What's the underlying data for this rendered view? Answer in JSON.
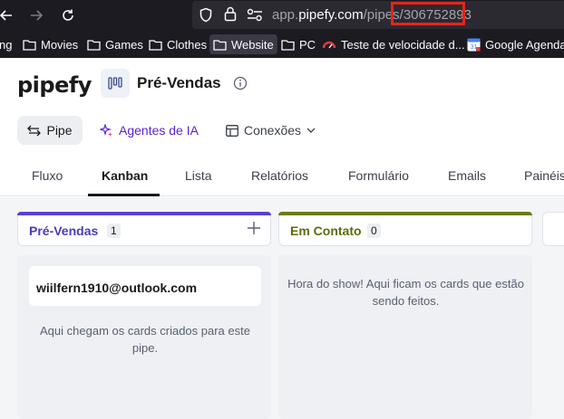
{
  "browser": {
    "url_prefix": "app.",
    "url_host": "pipefy.com",
    "url_path": "/pipes/",
    "url_pipe_id": "306752893"
  },
  "bookmarks": [
    {
      "label": "ng",
      "type": "folder"
    },
    {
      "label": "Movies",
      "type": "folder"
    },
    {
      "label": "Games",
      "type": "folder"
    },
    {
      "label": "Clothes",
      "type": "folder"
    },
    {
      "label": "Website",
      "type": "folder"
    },
    {
      "label": "PC",
      "type": "folder"
    },
    {
      "label": "Teste de velocidade d...",
      "type": "speedtest"
    },
    {
      "label": "Google Agenda",
      "type": "calendar"
    }
  ],
  "app": {
    "logo_text": "pipefy",
    "pipe_name": "Pré-Vendas",
    "buttons": {
      "pipe": "Pipe",
      "agents": "Agentes de IA",
      "connections": "Conexões"
    }
  },
  "tabs": [
    "Fluxo",
    "Kanban",
    "Lista",
    "Relatórios",
    "Formulário",
    "Emails",
    "Painéis"
  ],
  "active_tab": "Kanban",
  "columns": [
    {
      "title": "Pré-Vendas",
      "count": "1",
      "color": "#5b3fd6",
      "title_color": "#4b3bbd",
      "cards": [
        {
          "title": "wiilfern1910@outlook.com"
        }
      ],
      "description": "Aqui chegam os cards criados para este pipe."
    },
    {
      "title": "Em Contato",
      "count": "0",
      "color": "#6b7a10",
      "title_color": "#5f6b0c",
      "cards": [],
      "description": "Hora do show! Aqui ficam os cards que estão sendo feitos."
    }
  ],
  "colors": {
    "highlight": "#e5241a",
    "agents_accent": "#5b21d6",
    "browser_bg": "#1c1b22"
  }
}
